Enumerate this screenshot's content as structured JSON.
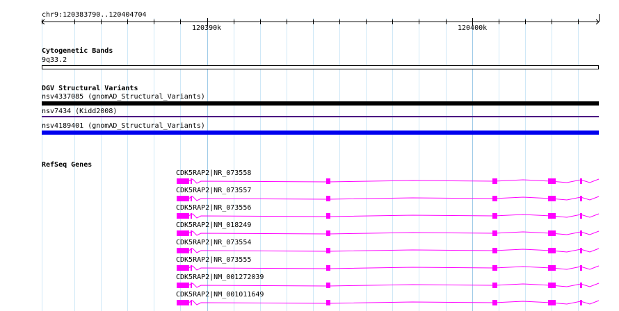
{
  "ruler": {
    "location": "chr9:120383790..120404704",
    "ticks": [
      "120390k",
      "120400k"
    ]
  },
  "cytoband": {
    "title": "Cytogenetic Bands",
    "band": "9q33.2"
  },
  "dgv": {
    "title": "DGV Structural Variants",
    "variants": [
      {
        "label": "nsv4337085 (gnomAD_Structural_Variants)",
        "color": "#000000"
      },
      {
        "label": "nsv7434 (Kidd2008)",
        "color": "#4b0082"
      },
      {
        "label": "nsv4189401 (gnomAD_Structural_Variants)",
        "color": "#0000ee"
      }
    ]
  },
  "refseq": {
    "title": "RefSeq Genes",
    "color": "#ff00ff",
    "transcripts": [
      {
        "label": "CDK5RAP2|NR_073558"
      },
      {
        "label": "CDK5RAP2|NR_073557"
      },
      {
        "label": "CDK5RAP2|NR_073556"
      },
      {
        "label": "CDK5RAP2|NM_018249"
      },
      {
        "label": "CDK5RAP2|NR_073554"
      },
      {
        "label": "CDK5RAP2|NR_073555"
      },
      {
        "label": "CDK5RAP2|NM_001272039"
      },
      {
        "label": "CDK5RAP2|NM_001011649"
      }
    ]
  }
}
